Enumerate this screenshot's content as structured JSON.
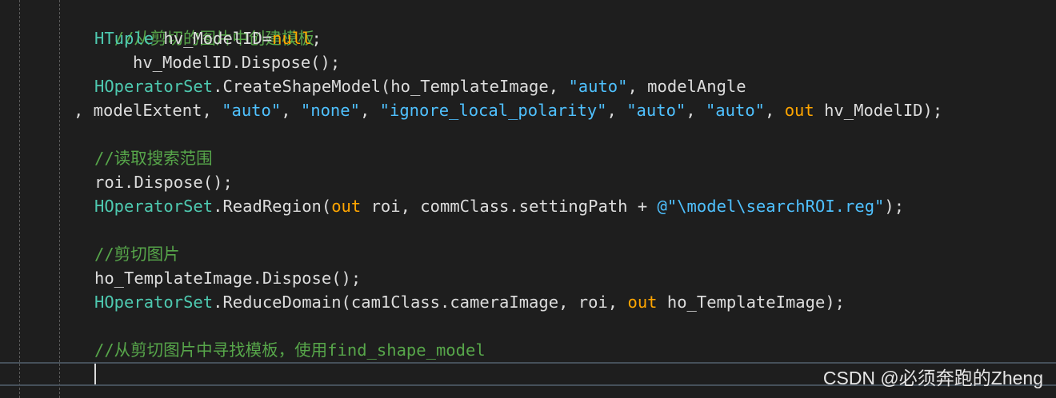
{
  "colors": {
    "background": "#1e1e1e",
    "comment": "#57a64a",
    "type": "#4ec9b0",
    "keyword": "#569cd6",
    "string": "#4fc1ff",
    "out_keyword": "#ffa500",
    "default_text": "#dcdcdc"
  },
  "editor": {
    "line1": {
      "comment": "//从剪切的图片中创建模板"
    },
    "line2": {
      "type": "HTuple",
      "var": " hv_ModelID=",
      "keyword": "null",
      "end": ";"
    },
    "line3": {
      "text": "hv_ModelID.Dispose();"
    },
    "line4": {
      "type": "HOperatorSet",
      "method": ".CreateShapeModel(ho_TemplateImage, ",
      "str1": "\"auto\"",
      "rest": ", modelAngle"
    },
    "line5": {
      "start": ", modelExtent, ",
      "str1": "\"auto\"",
      "sep1": ", ",
      "str2": "\"none\"",
      "sep2": ", ",
      "str3": "\"ignore_local_polarity\"",
      "sep3": ", ",
      "str4": "\"auto\"",
      "sep4": ", ",
      "str5": "\"auto\"",
      "sep5": ", ",
      "out": "out",
      "end": " hv_ModelID);"
    },
    "line7": {
      "comment": "//读取搜索范围"
    },
    "line8": {
      "text": "roi.Dispose();"
    },
    "line9": {
      "type": "HOperatorSet",
      "method": ".ReadRegion(",
      "out": "out",
      "mid": " roi, commClass.settingPath + ",
      "str": "@\"\\model\\searchROI.reg\"",
      "end": ");"
    },
    "line11": {
      "comment": "//剪切图片"
    },
    "line12": {
      "text": "ho_TemplateImage.Dispose();"
    },
    "line13": {
      "type": "HOperatorSet",
      "method": ".ReduceDomain(cam1Class.cameraImage, roi, ",
      "out": "out",
      "end": " ho_TemplateImage);"
    },
    "line15": {
      "comment": "//从剪切图片中寻找模板，使用find_shape_model"
    }
  },
  "watermark": "CSDN @必须奔跑的Zheng"
}
